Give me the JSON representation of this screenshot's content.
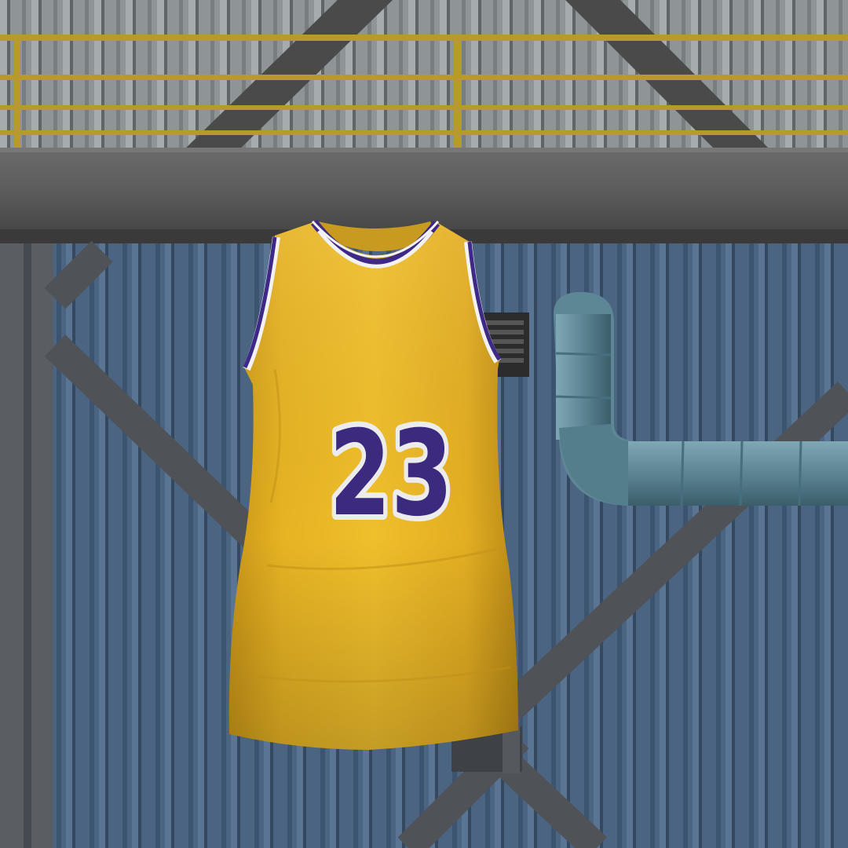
{
  "jersey": {
    "number": "23",
    "colors": {
      "body": "#e8b421",
      "body_shade": "#c9951a",
      "trim_purple": "#3e2a86",
      "trim_white": "#f2f2f2",
      "number_fill": "#3b2a7e"
    }
  },
  "environment": {
    "wall_color": "#46607e",
    "railing_color": "#b89a2a",
    "beam_color": "#5b5b5b",
    "pipe_color": "#5e8a9a"
  }
}
